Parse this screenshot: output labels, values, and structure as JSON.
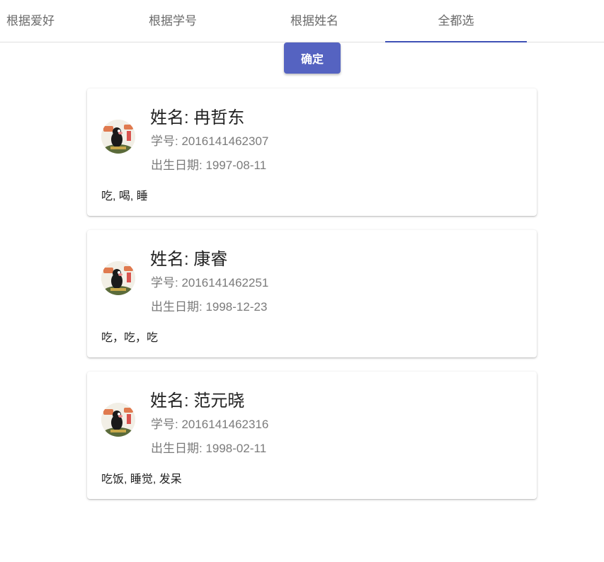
{
  "tabs": [
    {
      "label": "根据爱好",
      "active": false
    },
    {
      "label": "根据学号",
      "active": false
    },
    {
      "label": "根据姓名",
      "active": false
    },
    {
      "label": "全都选",
      "active": true
    }
  ],
  "confirm_label": "确定",
  "colors": {
    "accent": "#3f51b5",
    "button": "#5563c1"
  },
  "students": [
    {
      "name_label": "姓名: 冉哲东",
      "id_label": "学号: 2016141462307",
      "birth_label": "出生日期: 1997-08-11",
      "hobbies": "吃, 喝, 睡",
      "avatar_icon": "mole-cartoon-avatar"
    },
    {
      "name_label": "姓名: 康睿",
      "id_label": "学号: 2016141462251",
      "birth_label": "出生日期: 1998-12-23",
      "hobbies": "吃，吃，吃",
      "avatar_icon": "mole-cartoon-avatar"
    },
    {
      "name_label": "姓名: 范元晓",
      "id_label": "学号: 2016141462316",
      "birth_label": "出生日期: 1998-02-11",
      "hobbies": "吃饭, 睡觉, 发呆",
      "avatar_icon": "mole-cartoon-avatar"
    }
  ]
}
